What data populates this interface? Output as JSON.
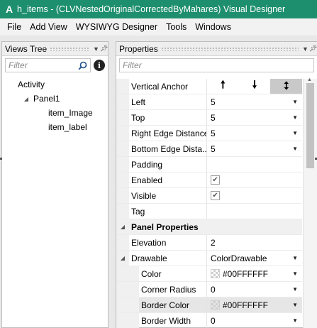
{
  "window": {
    "icon": "designer-app-icon",
    "title": "h_items - (CLVNestedOriginalCorrectedByMahares) Visual Designer"
  },
  "menu": [
    "File",
    "Add View",
    "WYSIWYG Designer",
    "Tools",
    "Windows"
  ],
  "views_tree": {
    "title": "Views Tree",
    "filter_placeholder": "Filter",
    "nodes": [
      {
        "label": "Activity",
        "level": 0,
        "expander": ""
      },
      {
        "label": "Panel1",
        "level": 1,
        "expander": "expanded"
      },
      {
        "label": "item_Image",
        "level": 2,
        "expander": ""
      },
      {
        "label": "item_label",
        "level": 2,
        "expander": ""
      }
    ]
  },
  "properties": {
    "title": "Properties",
    "filter_placeholder": "Filter",
    "vertical_anchor": {
      "label": "Vertical Anchor",
      "options": [
        "top",
        "bottom",
        "both"
      ],
      "selected": "both"
    },
    "rows": [
      {
        "name": "Left",
        "value": "5",
        "dropdown": true
      },
      {
        "name": "Top",
        "value": "5",
        "dropdown": true
      },
      {
        "name": "Right Edge Distance",
        "value": "5",
        "dropdown": true
      },
      {
        "name": "Bottom Edge Dista...",
        "value": "5",
        "dropdown": true
      },
      {
        "name": "Padding",
        "value": "",
        "dropdown": false
      },
      {
        "name": "Enabled",
        "checked": true
      },
      {
        "name": "Visible",
        "checked": true
      },
      {
        "name": "Tag",
        "value": "",
        "dropdown": false
      }
    ],
    "section": "Panel Properties",
    "elevation": {
      "name": "Elevation",
      "value": "2"
    },
    "drawable": {
      "name": "Drawable",
      "value": "ColorDrawable"
    },
    "drawable_children": [
      {
        "name": "Color",
        "value": "#00FFFFFF",
        "swatch": true
      },
      {
        "name": "Corner Radius",
        "value": "0",
        "swatch": false
      },
      {
        "name": "Border Color",
        "value": "#00FFFFFF",
        "swatch": true
      },
      {
        "name": "Border Width",
        "value": "0",
        "swatch": false
      }
    ]
  },
  "colors": {
    "titlebar": "#1e8f6e",
    "selected_row": "#e6e6e6"
  }
}
